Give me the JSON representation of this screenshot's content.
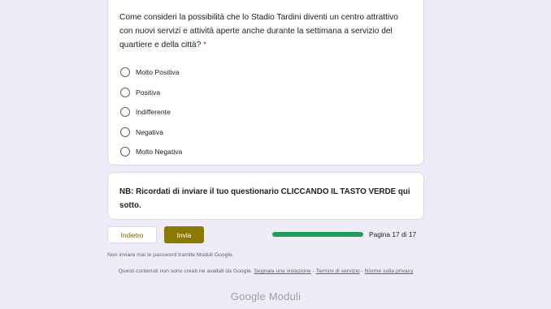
{
  "question": {
    "title": "Come consideri la possibilità che lo Stadio Tardini diventi un centro attrattivo con nuovi servizi e attività aperte anche durante la settimana a servizio del quartiere e della città?",
    "required_mark": "*",
    "options": [
      {
        "label": "Molto Positiva"
      },
      {
        "label": "Positiva"
      },
      {
        "label": "Indifferente"
      },
      {
        "label": "Negativa"
      },
      {
        "label": "Molto Negativa"
      }
    ]
  },
  "note": {
    "text": "NB: Ricordati di inviare il tuo questionario CLICCANDO IL TASTO VERDE qui sotto."
  },
  "navigation": {
    "back_label": "Indietro",
    "submit_label": "Invia",
    "progress": 1.0,
    "page_label": "Pagina 17 di 17"
  },
  "footer": {
    "password_warning": "Non inviare mai le password tramite Moduli Google.",
    "disclaimer_prefix": "Questi contenuti non sono creati né avallati da Google.",
    "report_link": "Segnala una violazione",
    "separator": " - ",
    "terms_link": "Termini di servizio",
    "privacy_link": "Norme sulla privacy",
    "logo_google": "Google",
    "logo_product": "Moduli"
  },
  "colors": {
    "background": "#f0ebf8",
    "accent": "#8a7a00",
    "progress": "#1e9e57"
  }
}
